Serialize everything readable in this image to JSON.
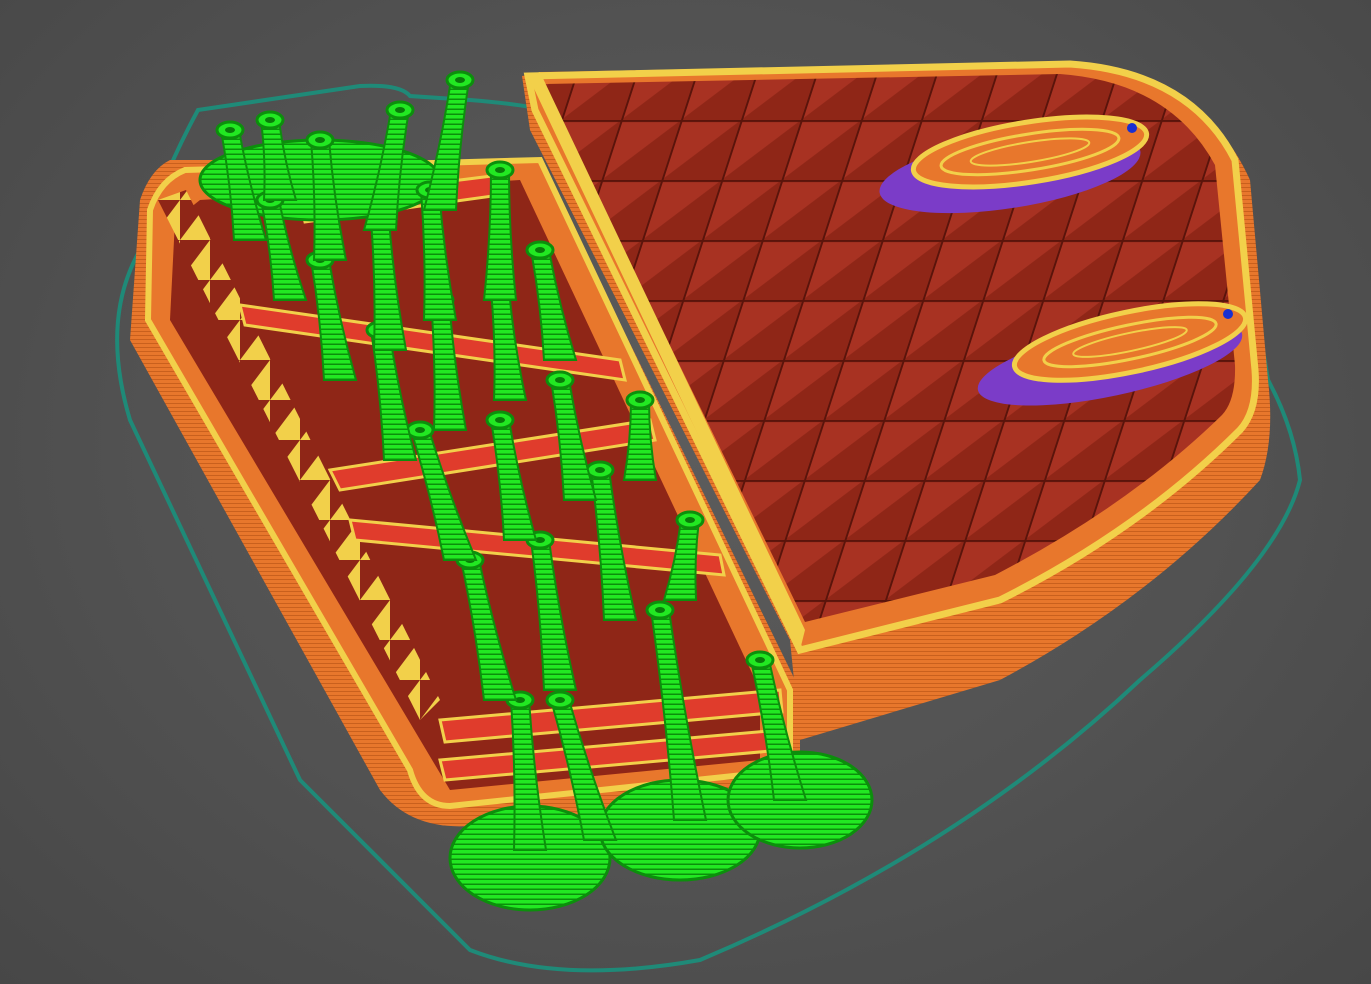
{
  "view": {
    "kind": "3d-slicer-gcode-preview",
    "background_color": "#555555",
    "feature_colors": {
      "skirt": "#1f8a78",
      "perimeter": "#e8772c",
      "external_perimeter_edge": "#f2d04a",
      "infill": "#9b2a1c",
      "infill_dark": "#6e1a10",
      "top_surface": "#e03c2c",
      "support": "#16e016",
      "support_dark": "#0a9a0a",
      "overhang": "#7b3cc8",
      "seam": "#1830d0"
    },
    "legend_items": [
      "skirt",
      "perimeter",
      "external-perimeter",
      "infill",
      "top-surface",
      "support",
      "overhang",
      "seam"
    ]
  }
}
